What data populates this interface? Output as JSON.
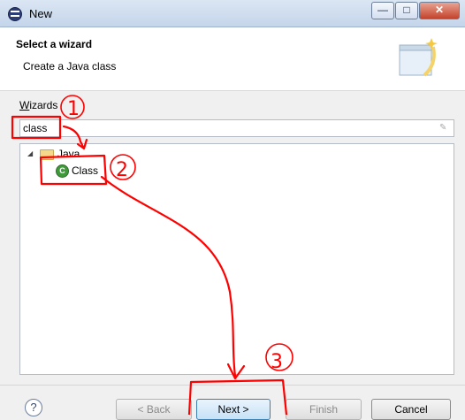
{
  "window": {
    "title": "New",
    "minimize": "—",
    "maximize": "□",
    "close": "✕"
  },
  "header": {
    "title": "Select a wizard",
    "description": "Create a Java class",
    "banner_icon": "wizard-banner-icon"
  },
  "wizards": {
    "label_mnemonic": "W",
    "label_rest": "izards",
    "filter_value": "class",
    "clear_icon": "✎"
  },
  "tree": {
    "folder": {
      "label": "Java",
      "expanded": true
    },
    "item": {
      "label": "Class",
      "icon_glyph": "C",
      "selected": false
    }
  },
  "buttons": {
    "back": "< Back",
    "next": "Next >",
    "finish": "Finish",
    "cancel": "Cancel",
    "help": "?"
  },
  "annotations": {
    "step1": "1",
    "step2": "2",
    "step3": "3",
    "color": "#ff0000"
  }
}
